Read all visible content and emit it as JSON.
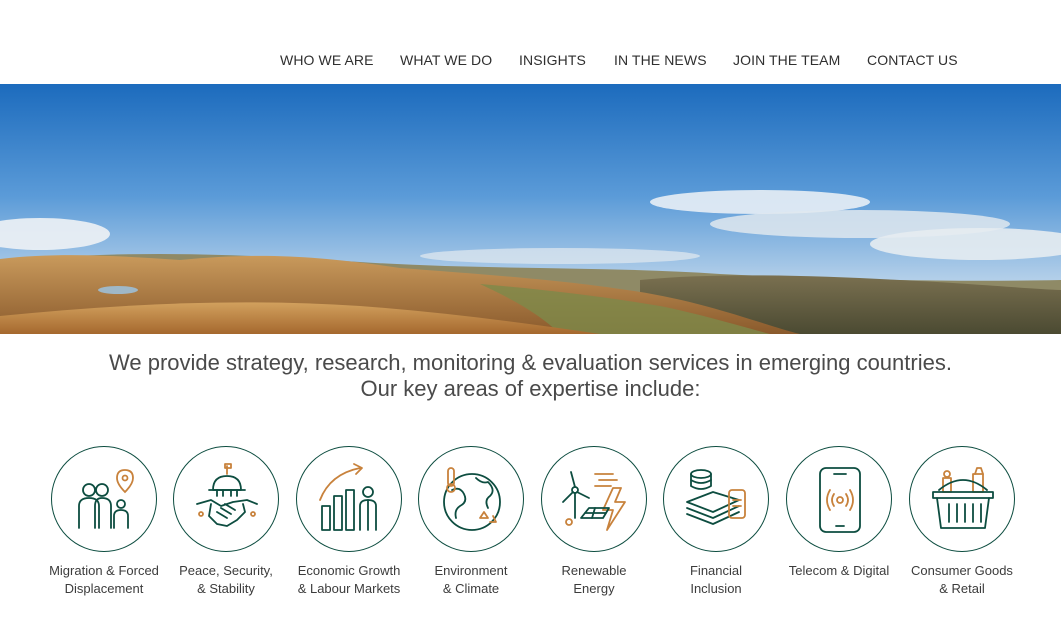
{
  "nav": {
    "items": [
      {
        "label": "WHO WE ARE"
      },
      {
        "label": "WHAT WE DO"
      },
      {
        "label": "INSIGHTS"
      },
      {
        "label": "IN THE NEWS"
      },
      {
        "label": "JOIN THE TEAM"
      },
      {
        "label": "CONTACT US"
      }
    ]
  },
  "tagline": {
    "line1": "We provide strategy, research, monitoring & evaluation services in emerging countries.",
    "line2": "Our key areas of expertise include:"
  },
  "areas": [
    {
      "line1": "Migration & Forced",
      "line2": "Displacement",
      "icon": "migration-icon"
    },
    {
      "line1": "Peace, Security,",
      "line2": "& Stability",
      "icon": "handshake-icon"
    },
    {
      "line1": "Economic Growth",
      "line2": "& Labour Markets",
      "icon": "growth-chart-icon"
    },
    {
      "line1": "Environment",
      "line2": "& Climate",
      "icon": "globe-climate-icon"
    },
    {
      "line1": "Renewable",
      "line2": "Energy",
      "icon": "renewable-energy-icon"
    },
    {
      "line1": "Financial",
      "line2": "Inclusion",
      "icon": "money-phone-icon"
    },
    {
      "line1": "Telecom & Digital",
      "line2": "",
      "icon": "smartphone-signal-icon"
    },
    {
      "line1": "Consumer Goods",
      "line2": "& Retail",
      "icon": "shopping-basket-icon"
    }
  ],
  "colors": {
    "icon_primary": "#0d4d40",
    "icon_accent": "#c8823c",
    "sky_top": "#1f6fc0",
    "hills": "#b98a4e"
  }
}
